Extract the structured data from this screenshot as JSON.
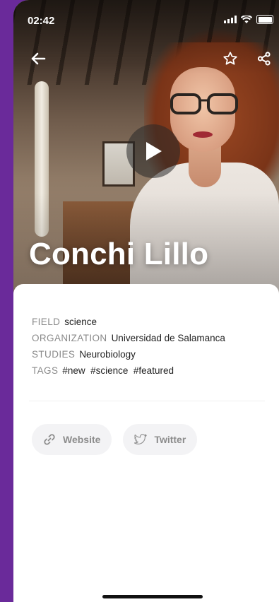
{
  "status_bar": {
    "time": "02:42"
  },
  "profile": {
    "name": "Conchi Lillo",
    "details": [
      {
        "label": "FIELD",
        "value": "science"
      },
      {
        "label": "ORGANIZATION",
        "value": "Universidad de Salamanca"
      },
      {
        "label": "STUDIES",
        "value": "Neurobiology"
      },
      {
        "label": "TAGS",
        "value": "#new  #science  #featured"
      }
    ]
  },
  "links": {
    "website_label": "Website",
    "twitter_label": "Twitter"
  },
  "icons": {
    "back": "arrow-left-icon",
    "favorite": "star-icon",
    "share": "share-icon",
    "play": "play-icon",
    "website": "link-icon",
    "twitter": "twitter-icon"
  },
  "colors": {
    "frame": "#6a2a9a",
    "label_gray": "#8a8a8a",
    "pill_bg": "#f3f3f5"
  }
}
